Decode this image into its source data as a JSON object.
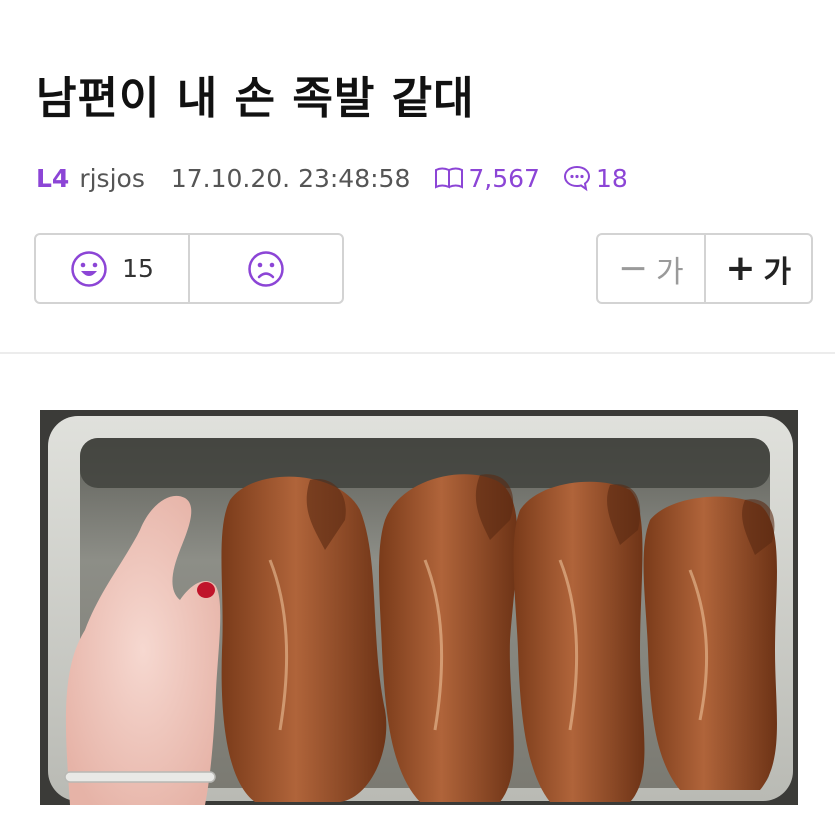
{
  "post": {
    "title": "남편이 내 손 족발 같대",
    "level": "L4",
    "author": "rjsjos",
    "date": "17.10.20. 23:48:58",
    "views": "7,567",
    "comments": "18"
  },
  "votes": {
    "like_count": "15"
  },
  "font_controls": {
    "decrease_label": "가",
    "increase_label": "가"
  },
  "colors": {
    "accent": "#8c45d6",
    "border": "#d3d3d3"
  },
  "icons": {
    "views": "book-icon",
    "comments": "chat-bubble-icon",
    "like": "smile-icon",
    "dislike": "frown-icon"
  }
}
